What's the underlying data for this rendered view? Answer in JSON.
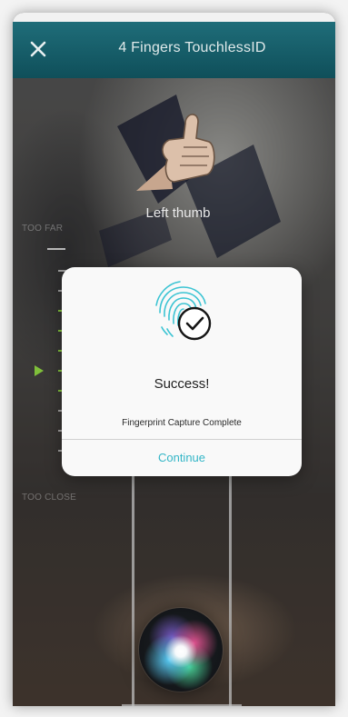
{
  "header": {
    "title": "4 Fingers TouchlessID",
    "close_icon": "close-icon"
  },
  "capture": {
    "finger_label": "Left thumb"
  },
  "distance_guide": {
    "top_label": "TOO FAR",
    "bottom_label": "TOO CLOSE",
    "accent_color": "#7fbf3a"
  },
  "dialog": {
    "title": "Success!",
    "message": "Fingerprint Capture Complete",
    "button_label": "Continue",
    "icon": "fingerprint-check-icon",
    "accent_color": "#34b6c7"
  },
  "colors": {
    "header_top": "#1f6d79",
    "header_bottom": "#0f4f5a"
  }
}
